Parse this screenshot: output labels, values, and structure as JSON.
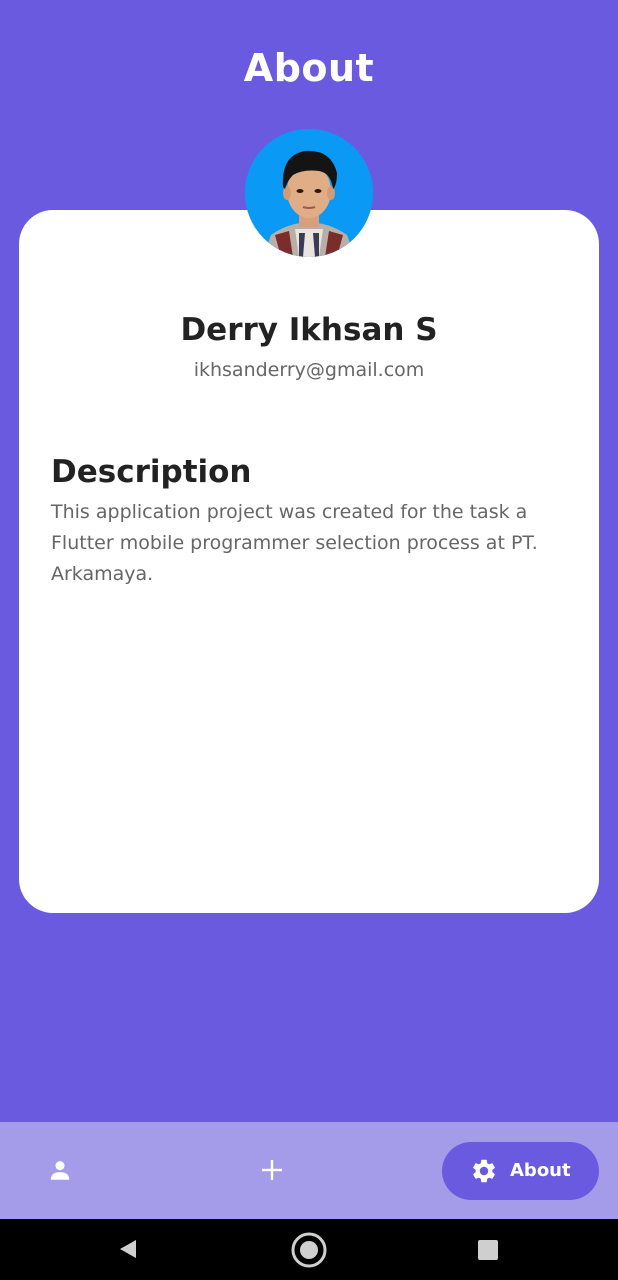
{
  "header": {
    "title": "About"
  },
  "profile": {
    "name": "Derry Ikhsan S",
    "email": "ikhsanderry@gmail.com"
  },
  "description": {
    "heading": "Description",
    "text": "This application project was created for the task a Flutter mobile programmer selection process at PT. Arkamaya."
  },
  "bottom_nav": {
    "items": [
      {
        "icon": "person-icon",
        "label": "",
        "active": false
      },
      {
        "icon": "add-icon",
        "label": "",
        "active": false
      },
      {
        "icon": "gear-icon",
        "label": "About",
        "active": true
      }
    ]
  },
  "system_nav": {
    "buttons": [
      "back-icon",
      "home-icon",
      "recents-icon"
    ]
  },
  "colors": {
    "primary": "#6a5ae0",
    "nav_background": "#a49ce9",
    "card": "#ffffff",
    "avatar_background": "#0a9af5"
  }
}
